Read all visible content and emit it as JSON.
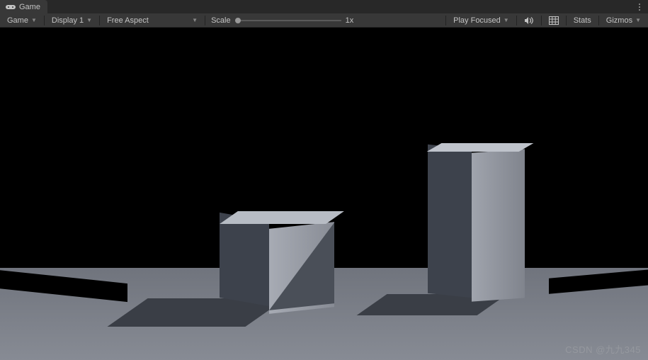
{
  "tab": {
    "title": "Game"
  },
  "toolbar": {
    "view_label": "Game",
    "display_label": "Display 1",
    "aspect_label": "Free Aspect",
    "scale_label": "Scale",
    "scale_value": "1x",
    "play_mode_label": "Play Focused",
    "stats_label": "Stats",
    "gizmos_label": "Gizmos"
  },
  "watermark": "CSDN @九九345"
}
